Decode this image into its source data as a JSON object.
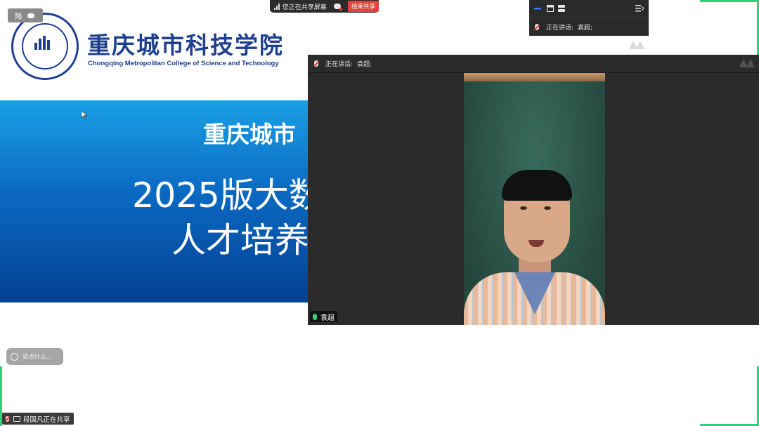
{
  "slide": {
    "school_name_cn": "重庆城市科技学院",
    "school_name_en": "Chongqing Metropolitan College of Science and Technology",
    "band_line1": "重庆城市",
    "band_line2": "2025版大数",
    "band_line3": "人才培养"
  },
  "share_bar": {
    "status_text": "您正在共享屏幕",
    "end_button": "结束共享"
  },
  "top_left_chip": {
    "text": "隔"
  },
  "top_right_panel": {
    "speaking_label": "正在讲话:",
    "speaking_name": "袁超;"
  },
  "video_window": {
    "speaking_label": "正在讲话:",
    "speaking_name": "袁超;",
    "participant_name": "袁超"
  },
  "chat": {
    "placeholder": "说点什么..."
  },
  "status": {
    "text": "段国凡正在共享"
  },
  "colors": {
    "accent_green": "#2fd17a",
    "end_share_red": "#e0443a",
    "slide_blue": "#0b6ac2",
    "panel_dark": "#2a2b2a"
  }
}
